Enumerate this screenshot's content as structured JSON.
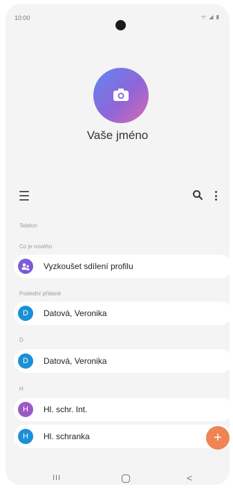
{
  "status": {
    "time": "10:00",
    "icons": "ᯤ ◢ ▮"
  },
  "profile": {
    "name": "Vaše jméno",
    "camera_icon": "camera-icon"
  },
  "sections": {
    "telefon": "Telefon",
    "new": "Co je nového",
    "recent": "Poslední přidané",
    "group_d": "D",
    "group_h": "H"
  },
  "contacts": {
    "share": {
      "initial": "",
      "label": "Vyzkoušet sdílení profilu",
      "color": "#7d5ad9"
    },
    "recent1": {
      "initial": "D",
      "label": "Datová, Veronika",
      "color": "#1b8fd7"
    },
    "d1": {
      "initial": "D",
      "label": "Datová, Veronika",
      "color": "#1b8fd7"
    },
    "h1": {
      "initial": "H",
      "label": "Hl. schr. Int.",
      "color": "#9b59c7"
    },
    "h2": {
      "initial": "H",
      "label": "Hl. schranka",
      "color": "#1b8fd7"
    }
  },
  "fab": {
    "label": "+"
  },
  "nav": {
    "recents": "III",
    "back": "<"
  },
  "colors": {
    "fab": "#f08453",
    "background": "#f4f4f4",
    "accent": "#1b8fd7"
  }
}
